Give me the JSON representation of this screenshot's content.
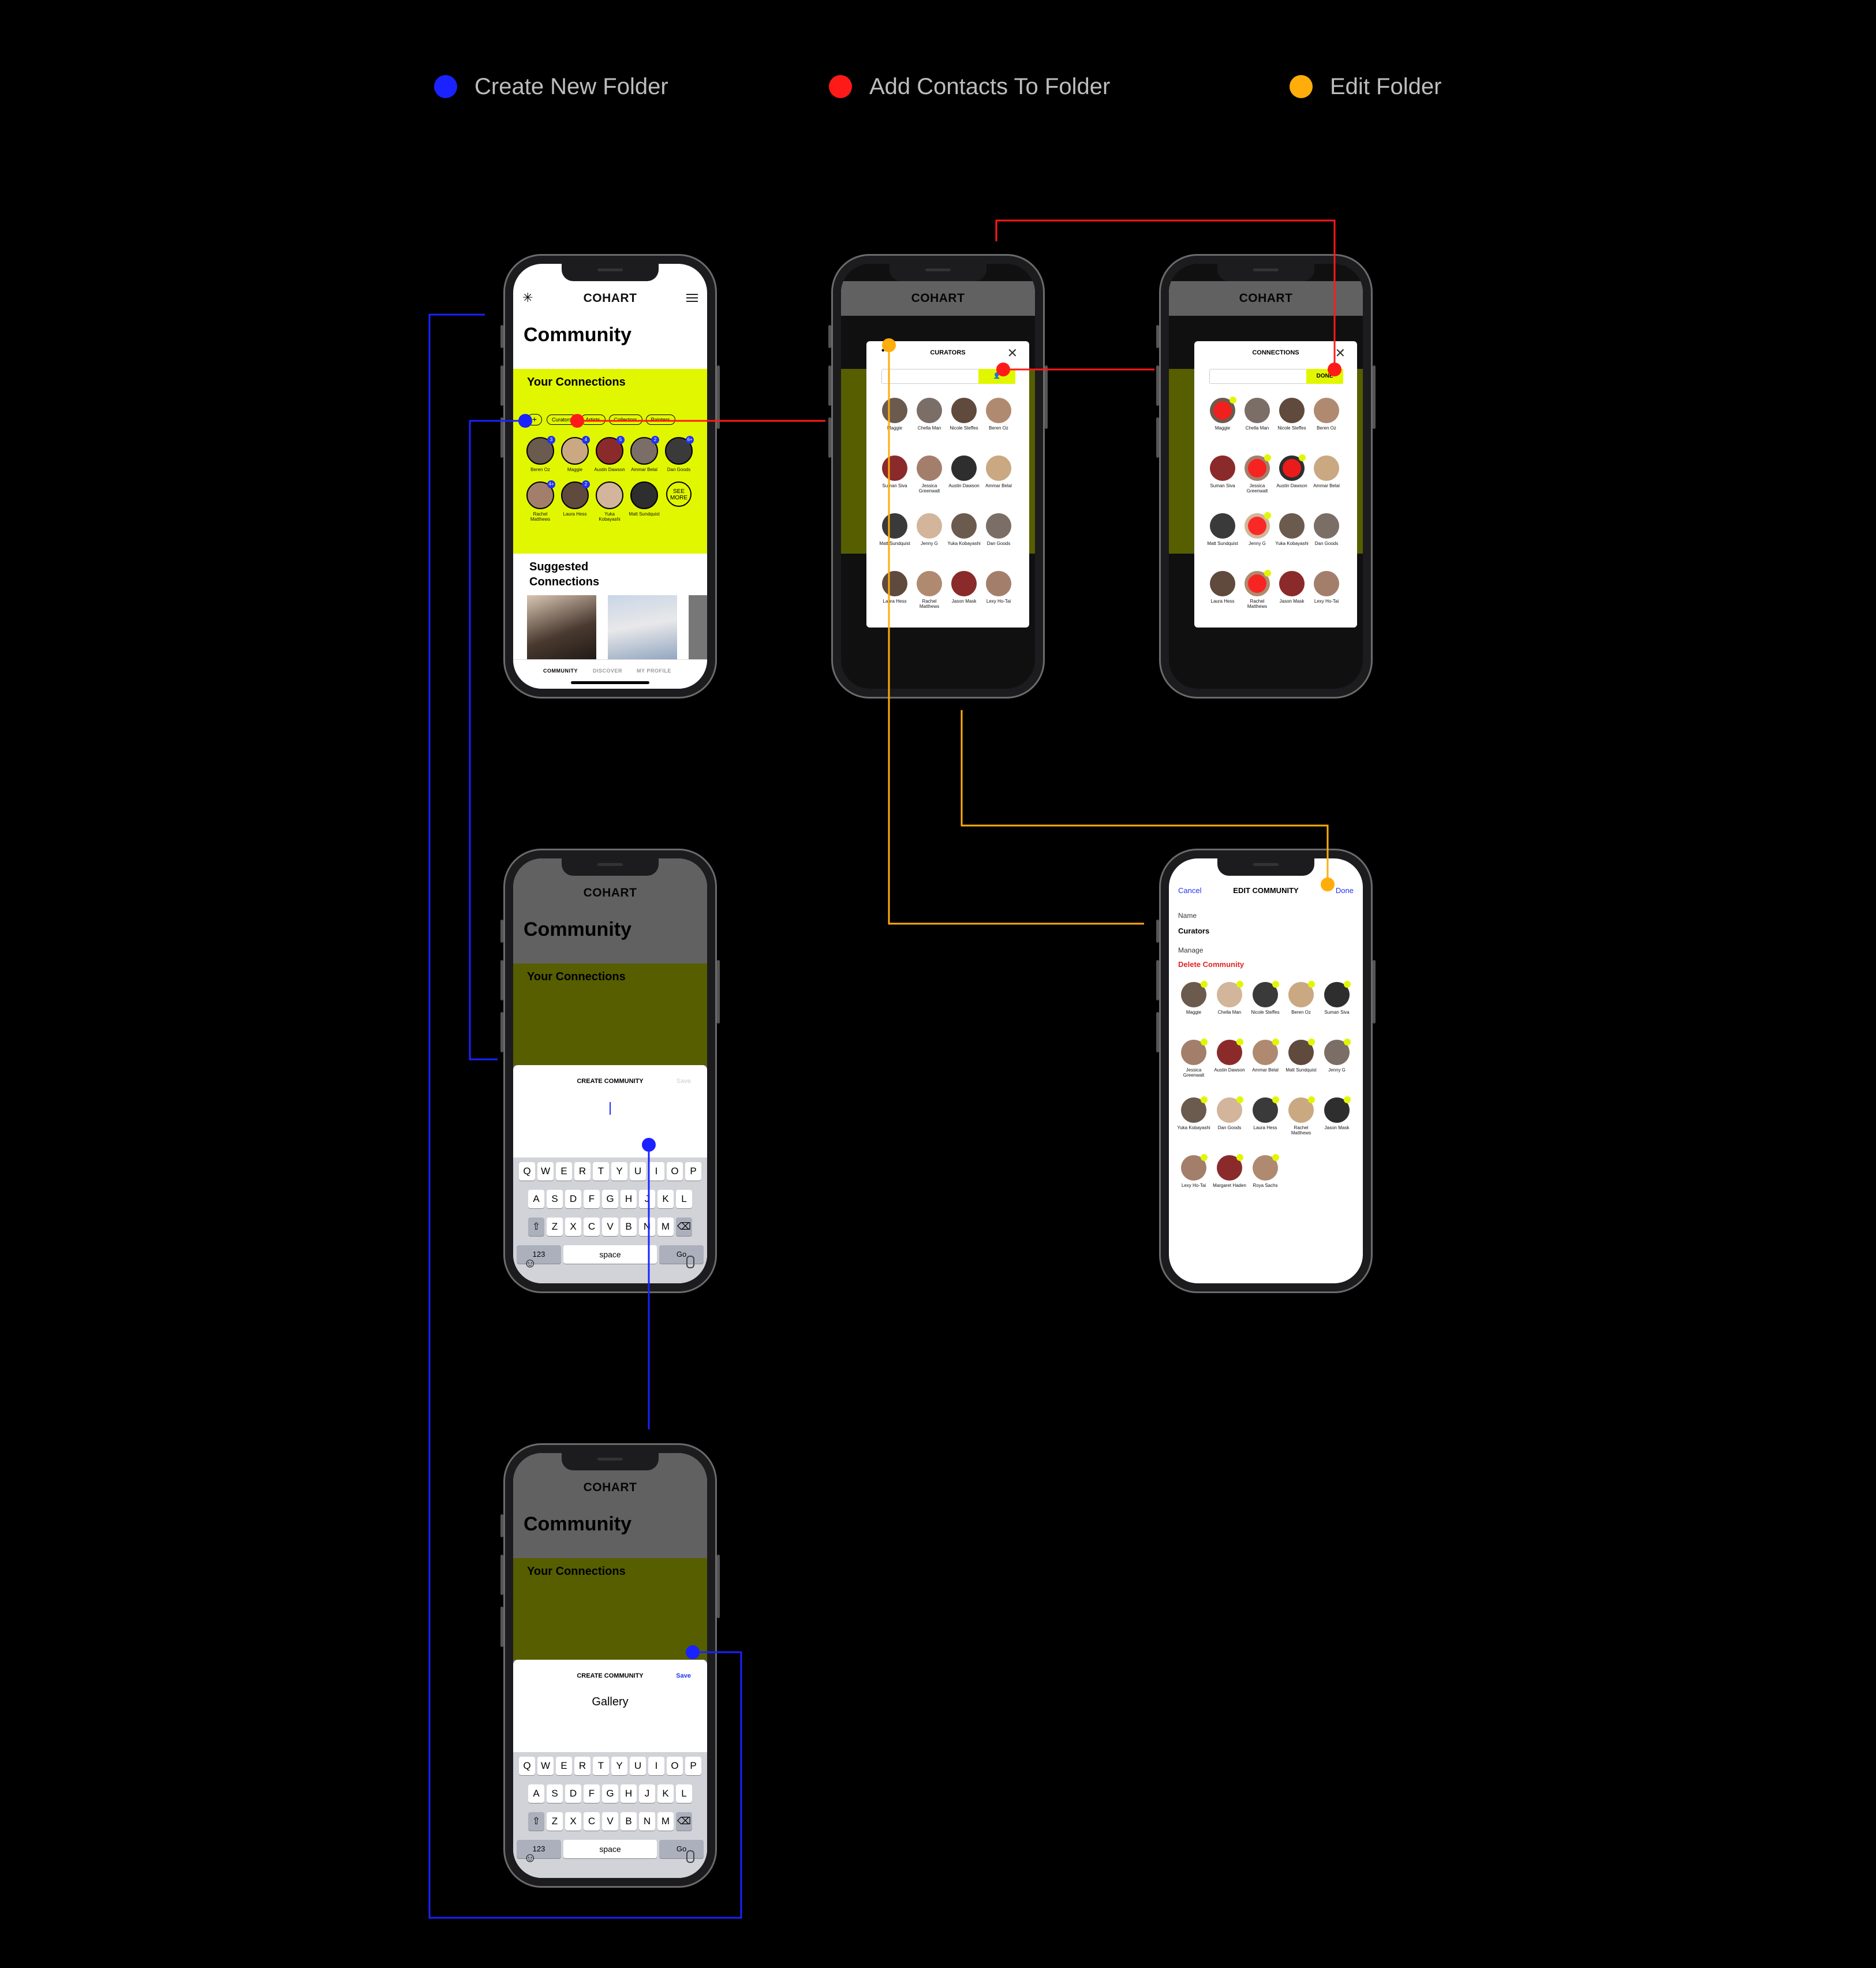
{
  "legend": [
    {
      "label": "Create New Folder",
      "color": "#1a22ff"
    },
    {
      "label": "Add Contacts To Folder",
      "color": "#ff1a1a"
    },
    {
      "label": "Edit Folder",
      "color": "#ffad0a"
    }
  ],
  "colors": {
    "accent": "#e1f700",
    "blue_flow": "#1a22ff",
    "red_flow": "#ff1a1a",
    "orange_flow": "#ffad0a"
  },
  "app": {
    "brand": "COHART",
    "logo_icon": "asterisk-logo-icon",
    "menu_icon": "hamburger-menu-icon",
    "page_title": "Community",
    "connections_title": "Your Connections",
    "add_chip": "+",
    "chips": [
      "Curators",
      "Artists",
      "Collectors",
      "Painters"
    ],
    "connections": [
      {
        "name": "Beren Oz",
        "badge": "3"
      },
      {
        "name": "Maggie",
        "badge": "4"
      },
      {
        "name": "Austin Dawson",
        "badge": "5"
      },
      {
        "name": "Ammar Belal",
        "badge": "2"
      },
      {
        "name": "Dan Goods",
        "badge": "6+"
      },
      {
        "name": "Rachel Matthews",
        "badge": "4+"
      },
      {
        "name": "Laura Hess",
        "badge": "2"
      },
      {
        "name": "Yuka Kobayashi",
        "badge": ""
      },
      {
        "name": "Matt Sundquist",
        "badge": ""
      }
    ],
    "see_more": "SEE MORE",
    "suggested_title": "Suggested Connections",
    "tabs": [
      "COMMUNITY",
      "DISCOVER",
      "MY PROFILE"
    ]
  },
  "curators_modal": {
    "title": "CURATORS",
    "more_icon": "ellipsis-icon",
    "close_icon": "close-icon",
    "search_icon": "search-icon",
    "add_icon": "add-person-icon",
    "people": [
      "Maggie",
      "Chella Man",
      "Nicole Steffes",
      "Beren Oz",
      "Suman Siva",
      "Jessica Greenwalt",
      "Austin Dawson",
      "Ammar Belal",
      "Matt Sundquist",
      "Jenny G",
      "Yuka Kobayashi",
      "Dan Goods",
      "Laura Hess",
      "Rachel Matthews",
      "Jason Mask",
      "Lexy Ho-Tai"
    ]
  },
  "connections_modal": {
    "title": "CONNECTIONS",
    "done": "DONE",
    "people": [
      "Maggie",
      "Chella Man",
      "Nicole Steffes",
      "Beren Oz",
      "Suman Siva",
      "Jessica Greenwalt",
      "Austin Dawson",
      "Ammar Belal",
      "Matt Sundquist",
      "Jenny G",
      "Yuka Kobayashi",
      "Dan Goods",
      "Laura Hess",
      "Rachel Matthews",
      "Jason Mask",
      "Lexy Ho-Tai"
    ]
  },
  "create_sheet": {
    "title": "CREATE COMMUNITY",
    "save": "Save",
    "typed_value": "Gallery"
  },
  "keyboard": {
    "row1": [
      "Q",
      "W",
      "E",
      "R",
      "T",
      "Y",
      "U",
      "I",
      "O",
      "P"
    ],
    "row2": [
      "A",
      "S",
      "D",
      "F",
      "G",
      "H",
      "J",
      "K",
      "L"
    ],
    "row3": [
      "Z",
      "X",
      "C",
      "V",
      "B",
      "N",
      "M"
    ],
    "numbers": "123",
    "space": "space",
    "go": "Go"
  },
  "edit_community": {
    "cancel": "Cancel",
    "title": "EDIT COMMUNITY",
    "done": "Done",
    "name_label": "Name",
    "name_value": "Curators",
    "manage_label": "Manage",
    "delete": "Delete Community",
    "members": [
      "Maggie",
      "Chella Man",
      "Nicole Steffes",
      "Beren Oz",
      "Suman Siva",
      "Jessica Greenwalt",
      "Austin Dawson",
      "Ammar Belal",
      "Matt Sundquist",
      "Jenny G",
      "Yuka Kobayashi",
      "Dan Goods",
      "Laura Hess",
      "Rachel Matthews",
      "Jason Mask",
      "Lexy Ho-Tai",
      "Margaret Haden",
      "Roya Sachs"
    ]
  }
}
